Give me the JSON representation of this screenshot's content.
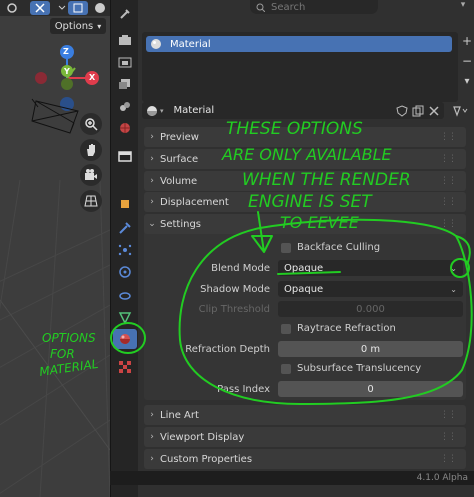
{
  "viewport": {
    "options_label": "Options",
    "gizmo": {
      "z": "Z",
      "y": "Y",
      "x": "X"
    }
  },
  "search": {
    "placeholder": "Search"
  },
  "slot_list": {
    "items": [
      {
        "label": "Material"
      }
    ]
  },
  "material": {
    "name": "Material"
  },
  "panels": {
    "preview": "Preview",
    "surface": "Surface",
    "volume": "Volume",
    "displacement": "Displacement",
    "settings": "Settings",
    "line_art": "Line Art",
    "viewport_display": "Viewport Display",
    "custom_properties": "Custom Properties"
  },
  "settings": {
    "backface_culling": {
      "label": "Backface Culling",
      "checked": false
    },
    "blend_mode": {
      "label": "Blend Mode",
      "value": "Opaque"
    },
    "shadow_mode": {
      "label": "Shadow Mode",
      "value": "Opaque"
    },
    "clip_threshold": {
      "label": "Clip Threshold",
      "value": "0.000"
    },
    "raytrace_refraction": {
      "label": "Raytrace Refraction",
      "checked": false
    },
    "refraction_depth": {
      "label": "Refraction Depth",
      "value": "0 m"
    },
    "subsurface_translucency": {
      "label": "Subsurface Translucency",
      "checked": false
    },
    "pass_index": {
      "label": "Pass Index",
      "value": "0"
    }
  },
  "status_bar": {
    "version": "4.1.0 Alpha"
  },
  "annotations": {
    "note_lines": [
      "THESE OPTIONS",
      "ARE ONLY AVAILABLE",
      "WHEN THE RENDER",
      "ENGINE IS SET",
      "TO EEVEE"
    ],
    "side_lines": [
      "OPTIONS",
      "FOR",
      "MATERIAL"
    ]
  },
  "colors": {
    "selected": "#4772b3",
    "annotation": "#22cc22",
    "x_axis": "#e03c4c",
    "y_axis": "#7ab83a",
    "z_axis": "#3a7ee0"
  }
}
